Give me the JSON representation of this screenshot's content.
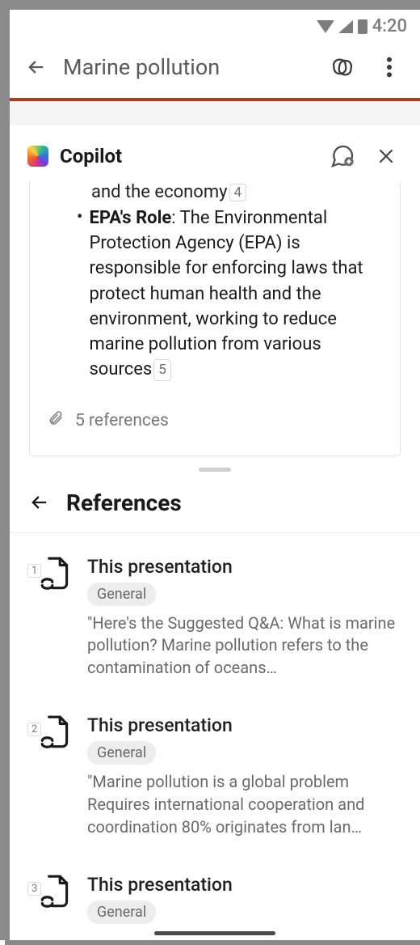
{
  "status": {
    "time": "4:20"
  },
  "appbar": {
    "title": "Marine pollution"
  },
  "copilot": {
    "title": "Copilot",
    "body_truncated_line": "and the economy",
    "body_truncated_cite": "4",
    "bullet_strong": "EPA's Role",
    "bullet_rest": ": The Environmental Protection Agency (EPA) is responsible for enforcing laws that protect human health and the environment, working to reduce marine pollution from various sources",
    "bullet_cite": "5",
    "references_summary": "5 references"
  },
  "refs": {
    "heading": "References",
    "items": [
      {
        "num": "1",
        "title": "This presentation",
        "badge": "General",
        "snip": "\"Here's the Suggested Q&A:   What is marine pollution?   Marine pollution refers to the contamination of oceans…"
      },
      {
        "num": "2",
        "title": "This presentation",
        "badge": "General",
        "snip": "\"Marine pollution is a global problem Requires international cooperation and coordination 80% originates from lan…"
      },
      {
        "num": "3",
        "title": "This presentation",
        "badge": "General",
        "snip": ""
      }
    ]
  }
}
